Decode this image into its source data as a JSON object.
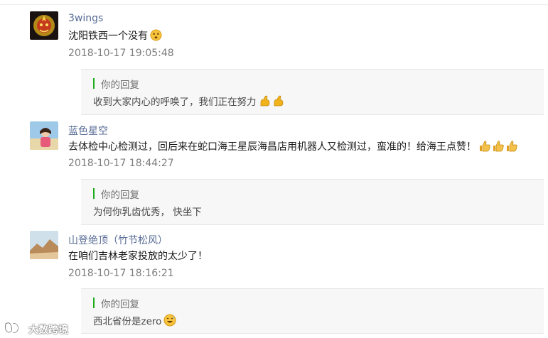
{
  "reply_label": "你的回复",
  "comments": [
    {
      "author": "3wings",
      "text": "沈阳铁西一个没有",
      "emojis": [
        "dizzy-face-emoji"
      ],
      "time": "2018-10-17 19:05:48",
      "reply": {
        "text": "收到大家内心的呼唤了，我们正在努力",
        "emojis": [
          "flexed-biceps-emoji",
          "flexed-biceps-emoji"
        ]
      }
    },
    {
      "author": "蓝色星空",
      "text": "去体检中心检测过，回后来在蛇口海王星辰海昌店用机器人又检测过，蛮准的！给海王点赞！",
      "emojis": [
        "thumbs-up-emoji",
        "thumbs-up-emoji",
        "thumbs-up-emoji"
      ],
      "time": "2018-10-17 18:44:27",
      "reply": {
        "text": "为何你乳齿优秀， 快坐下",
        "emojis": []
      }
    },
    {
      "author": "山登绝顶（竹节松风）",
      "text": "在咱们吉林老家投放的太少了！",
      "emojis": [],
      "time": "2018-10-17 18:16:21",
      "reply": {
        "text": "西北省份是zero",
        "emojis": [
          "grinning-sweat-emoji"
        ]
      }
    }
  ],
  "watermark": "大数跨境",
  "colors": {
    "author": "#576b95",
    "reply_bar": "#1aad19",
    "timestamp": "#7d7d7d"
  }
}
